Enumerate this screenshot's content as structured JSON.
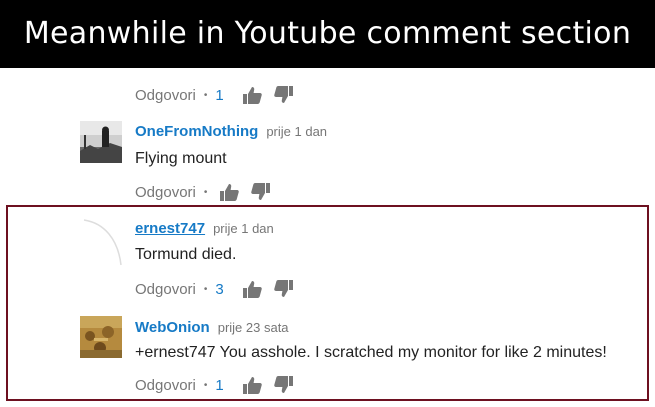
{
  "banner": {
    "text": "Meanwhile in Youtube comment section"
  },
  "reply_label": "Odgovori",
  "separator": "•",
  "top_actions": {
    "like_count": "1"
  },
  "comments": [
    {
      "author": "OneFromNothing",
      "time": "prije 1 dan",
      "text": "Flying mount",
      "like_count": ""
    },
    {
      "author": "ernest747",
      "time": "prije 1 dan",
      "text": "Tormund died.",
      "like_count": "3"
    },
    {
      "author": "WebOnion",
      "time": "prije 23 sata",
      "text": "+ernest747 You asshole. I scratched my monitor for like 2 minutes!",
      "like_count": "1"
    }
  ],
  "colors": {
    "link_blue": "#167ac6",
    "meta_gray": "#767676",
    "highlight_border": "#6d1020",
    "banner_bg": "#000000"
  },
  "icons": [
    "thumbs-up-icon",
    "thumbs-down-icon"
  ]
}
